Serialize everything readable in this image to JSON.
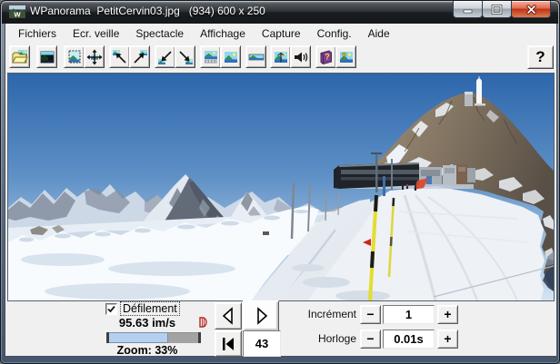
{
  "window": {
    "title": "WPanorama  PetitCervin03.jpg   (934) 600 x 250",
    "icon_letter": "w"
  },
  "menu": {
    "items": [
      "Fichiers",
      "Ecr. veille",
      "Spectacle",
      "Affichage",
      "Capture",
      "Config.",
      "Aide"
    ]
  },
  "toolbar": {
    "help_label": "?",
    "book_glyph": "?",
    "about_glyph": "?",
    "buttons": [
      "open-panorama",
      "screensaver-mode",
      "windowed-mode",
      "pan-all-directions",
      "scroll-up-left",
      "scroll-up-right",
      "scroll-down-left",
      "scroll-down-right",
      "panorama-with-filmstrip",
      "full-image-view",
      "panorama-strip-view",
      "image-with-mast",
      "sound",
      "help-contents",
      "about-image"
    ]
  },
  "image": {
    "filename": "PetitCervin03.jpg",
    "display_size": "600 x 250",
    "description": "Winter alpine panorama: Matterhorn and snowy range at left, Klein Matterhorn rocky summit with white antenna tower, summit buildings and groomed ski slope with yellow marker poles at right under a blue gradient sky."
  },
  "controls": {
    "defilement_label": "Défilement",
    "defilement_checked": true,
    "speed_value": "95.63 im/s",
    "progress_percent": 66,
    "zoom_label": "Zoom: 33%",
    "frame_number": "43",
    "increment_label": "Incrément",
    "increment_value": "1",
    "horloge_label": "Horloge",
    "horloge_value": "0.01s",
    "minus_label": "−",
    "plus_label": "+"
  }
}
